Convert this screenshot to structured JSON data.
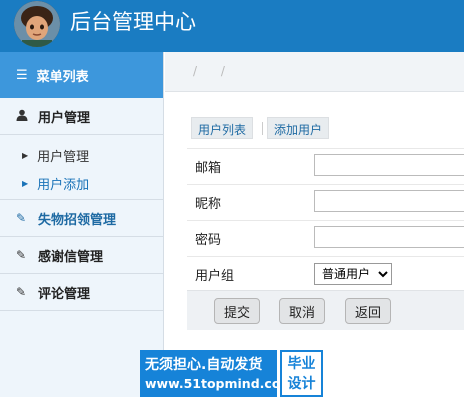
{
  "header": {
    "title": "后台管理中心"
  },
  "sidebar": {
    "menu_title": "菜单列表",
    "groups": [
      {
        "label": "用户管理",
        "icon": "user-icon"
      },
      {
        "label": "失物招领管理",
        "icon": "edit-icon"
      },
      {
        "label": "感谢信管理",
        "icon": "edit-icon"
      },
      {
        "label": "评论管理",
        "icon": "edit-icon"
      }
    ],
    "sub_items": [
      {
        "label": "用户管理",
        "active": false
      },
      {
        "label": "用户添加",
        "active": true
      }
    ]
  },
  "breadcrumb": {
    "text": "/ /"
  },
  "tabs": [
    {
      "label": "用户列表"
    },
    {
      "label": "添加用户"
    }
  ],
  "form": {
    "email_label": "邮箱",
    "nickname_label": "昵称",
    "password_label": "密码",
    "group_label": "用户组",
    "group_selected": "普通用户",
    "submit_label": "提交",
    "cancel_label": "取消",
    "back_label": "返回"
  },
  "watermark": {
    "line1": "无须担心.自动发货",
    "line2": "www.51topmind.com",
    "side_line1": "毕业",
    "side_line2": "设计"
  },
  "colors": {
    "header": "#1a7cc2",
    "menu_header": "#3d97dc",
    "active": "#1a73b8"
  }
}
